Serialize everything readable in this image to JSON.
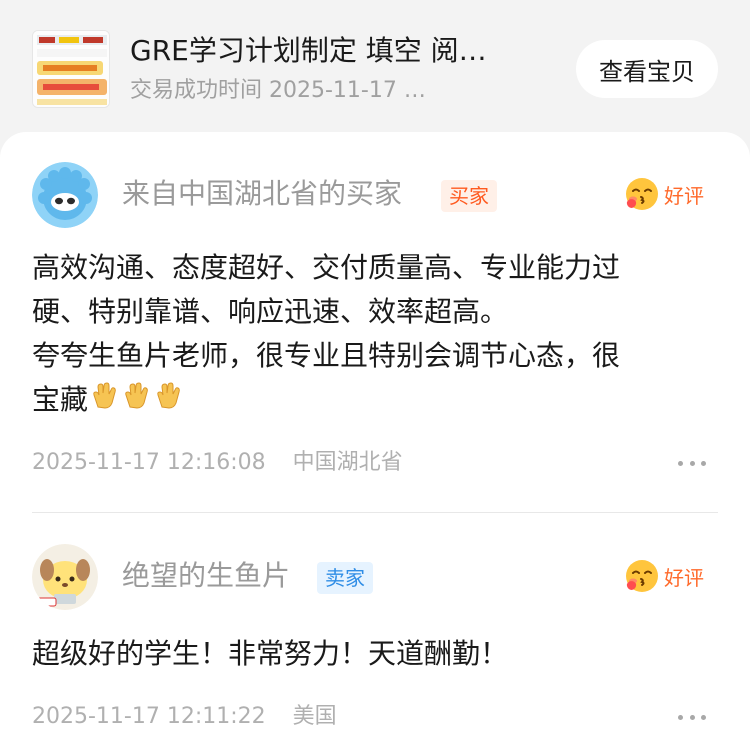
{
  "order": {
    "title": "GRE学习计划制定 填空 阅…",
    "subtitle": "交易成功时间 2025-11-17 …",
    "view_button": "查看宝贝"
  },
  "reviews": [
    {
      "reviewer": "来自中国湖北省的买家",
      "role": "买家",
      "rating": "好评",
      "lines": [
        "高效沟通、态度超好、交付质量高、专业能力过",
        "硬、特别靠谱、响应迅速、效率超高。",
        "夸夸生鱼片老师，很专业且特别会调节心态，很",
        "宝藏"
      ],
      "date": "2025-11-17 12:16:08",
      "location": "中国湖北省"
    },
    {
      "reviewer": "绝望的生鱼片",
      "role": "卖家",
      "rating": "好评",
      "lines": [
        "超级好的学生！非常努力！天道酬勤！"
      ],
      "date": "2025-11-17 12:11:22",
      "location": "美国"
    }
  ],
  "colors": {
    "accent_orange": "#ff5a1f",
    "seller_blue": "#2f8de6",
    "background": "#f3f3f3"
  },
  "icons": [
    "product-thumbnail",
    "smiley-kiss-icon",
    "clap-icon",
    "more-icon"
  ]
}
